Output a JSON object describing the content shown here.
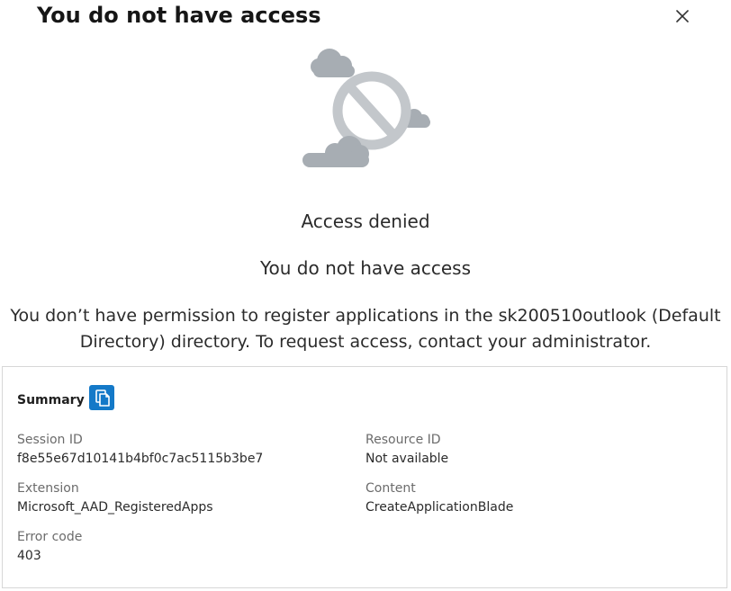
{
  "header": {
    "title": "You do not have access",
    "close_icon": "close-icon"
  },
  "illustration": {
    "icon": "access-denied-illustration",
    "colors": {
      "cloud": "#a7adb3",
      "ring": "#c3c7cb",
      "slash": "#c3c7cb"
    }
  },
  "main": {
    "heading": "Access denied",
    "subheading": "You do not have access",
    "message_line1": "You don’t have permission to register applications in the sk200510outlook (Default",
    "message_line2": "Directory) directory. To request access, contact your administrator."
  },
  "summary": {
    "label": "Summary",
    "copy_icon": "copy-icon",
    "accent_color": "#1479c8",
    "fields": {
      "session_id": {
        "label": "Session ID",
        "value": "f8e55e67d10141b4bf0c7ac5115b3be7"
      },
      "resource_id": {
        "label": "Resource ID",
        "value": "Not available"
      },
      "extension": {
        "label": "Extension",
        "value": "Microsoft_AAD_RegisteredApps"
      },
      "content": {
        "label": "Content",
        "value": "CreateApplicationBlade"
      },
      "error_code": {
        "label": "Error code",
        "value": "403"
      }
    }
  }
}
